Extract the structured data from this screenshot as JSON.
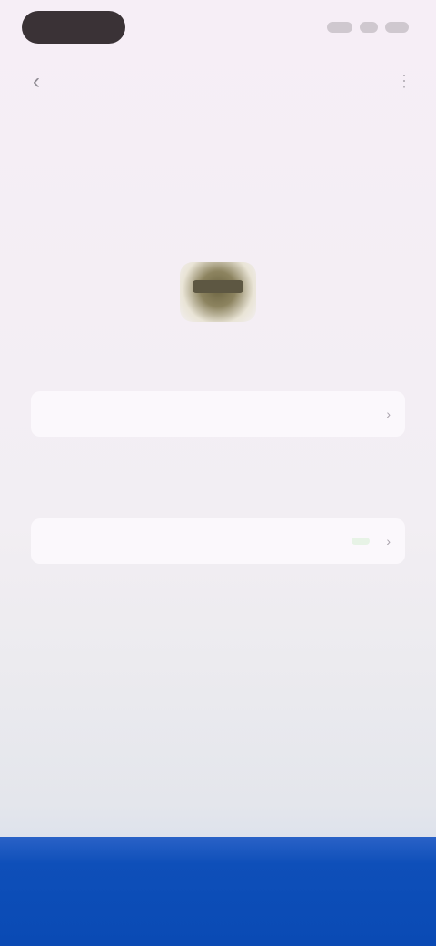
{
  "status_bar": {
    "time": "",
    "icons": [
      "signal-icon",
      "wifi-icon",
      "battery-icon"
    ]
  },
  "nav": {
    "title": "",
    "back_icon": "back-arrow-icon",
    "actions": [
      "more-icon"
    ]
  },
  "subtitle": "",
  "small_label": "",
  "logo": {
    "icon": "app-logo-icon"
  },
  "strong_label": "",
  "rows": [
    {
      "key": "",
      "value": "",
      "accent": "#a470b0"
    },
    {
      "key": "",
      "mid": "",
      "value": "",
      "accent": "#4e9a5e"
    }
  ],
  "link_line": {
    "text": "",
    "link": ""
  },
  "footer_text": "",
  "bottom_button": {
    "label": "",
    "color": "#0a4ab4"
  }
}
